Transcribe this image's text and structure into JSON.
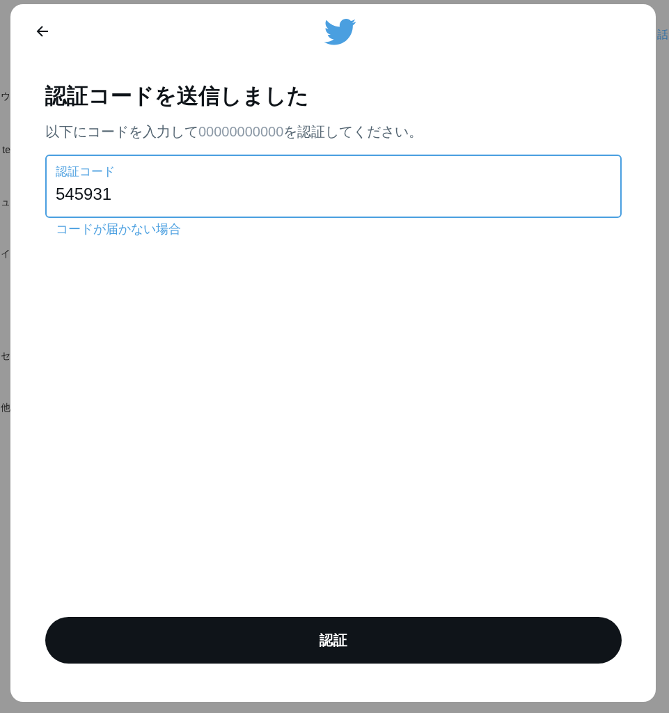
{
  "background": {
    "left_column": [
      "ウ",
      "te",
      "ュ",
      "イ",
      "セ",
      "他"
    ],
    "right_column": [
      "話"
    ]
  },
  "dialog": {
    "title": "認証コードを送信しました",
    "subtitle": {
      "before": "以下にコードを入力して",
      "phone": "00000000000",
      "after": "を認証してください。"
    },
    "code_field": {
      "label": "認証コード",
      "value": "545931",
      "focused": true
    },
    "help_link": "コードが届かない場合",
    "submit_button": "認証"
  }
}
